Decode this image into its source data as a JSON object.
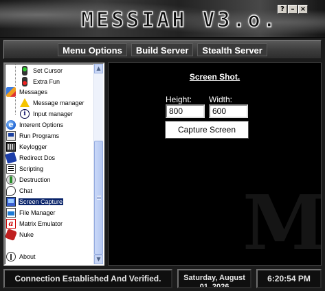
{
  "window": {
    "title": "MESSIAH V3.o.",
    "controls": {
      "help": "?",
      "minimize": "–",
      "close": "×"
    }
  },
  "nav": {
    "menu_options": "Menu Options",
    "build_server": "Build Server",
    "stealth_server": "Stealth Server"
  },
  "tree": {
    "items": [
      {
        "label": "Set Cursor",
        "icon": "traffic-light-green-icon"
      },
      {
        "label": "Extra Fun",
        "icon": "traffic-light-red-icon"
      },
      {
        "label": "Messages",
        "icon": "messages-icon"
      },
      {
        "label": "Message manager",
        "icon": "warning-icon"
      },
      {
        "label": "Input manager",
        "icon": "info-icon"
      },
      {
        "label": "Interent Options",
        "icon": "internet-explorer-icon"
      },
      {
        "label": "Run Programs",
        "icon": "run-programs-icon"
      },
      {
        "label": "Keylogger",
        "icon": "keyboard-icon"
      },
      {
        "label": "Redirect Dos",
        "icon": "redirect-icon"
      },
      {
        "label": "Scripting",
        "icon": "script-icon"
      },
      {
        "label": "Destruction",
        "icon": "destruction-icon"
      },
      {
        "label": "Chat",
        "icon": "chat-icon"
      },
      {
        "label": "Screen Capture",
        "icon": "screen-capture-icon"
      },
      {
        "label": "File Manager",
        "icon": "file-manager-icon"
      },
      {
        "label": "Matrix Emulator",
        "icon": "matrix-icon"
      },
      {
        "label": "Nuke",
        "icon": "nuke-icon"
      },
      {
        "label": "About",
        "icon": "about-icon"
      }
    ],
    "selected": "Screen Capture"
  },
  "screenshot_panel": {
    "title": "Screen Shot.",
    "height_label": "Height:",
    "height_value": "800",
    "width_label": "Width:",
    "width_value": "600",
    "capture_button": "Capture Screen",
    "watermark": "M"
  },
  "status": {
    "connection": "Connection Established And Verified.",
    "date": "Saturday, August 01, 2026",
    "time": "6:20:54 PM"
  },
  "colors": {
    "selection": "#0a246a",
    "main_background": "#000000",
    "status_text": "#e6e6e6"
  }
}
